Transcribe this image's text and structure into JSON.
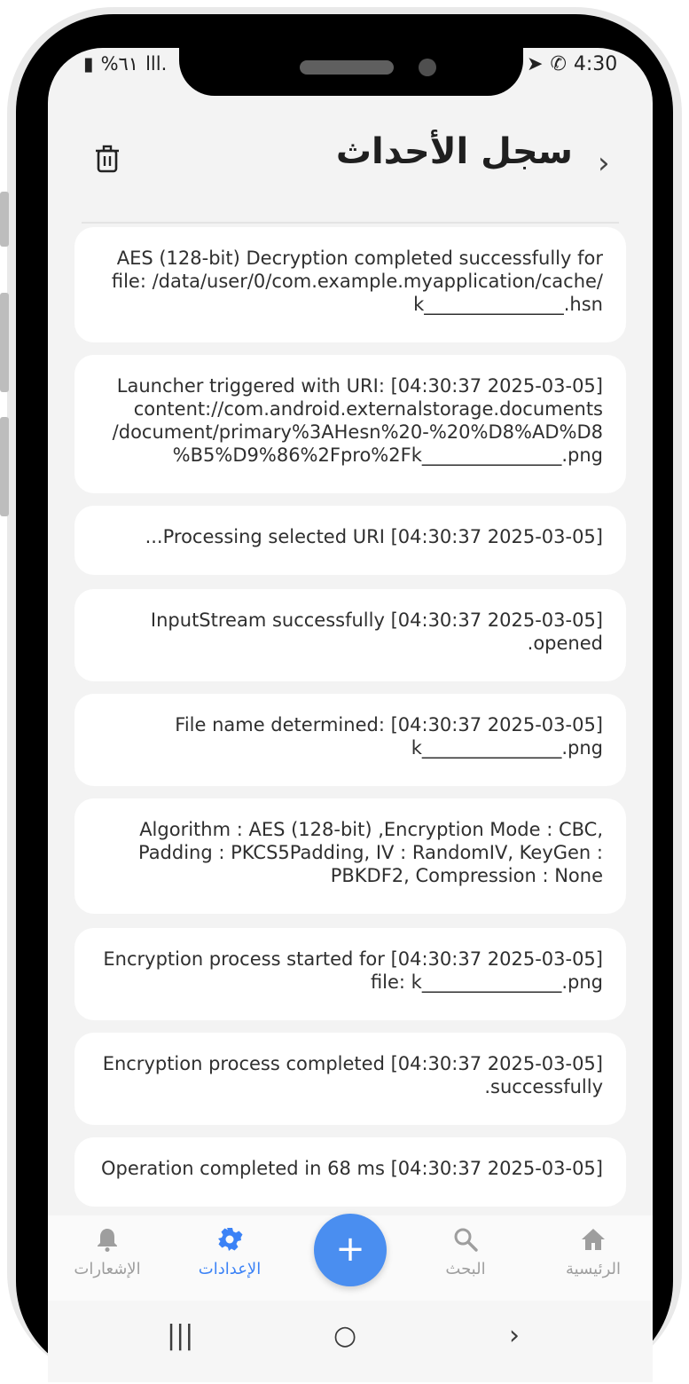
{
  "status_bar": {
    "battery_pct": "%٦١",
    "signal": "lll.",
    "time": "4:30"
  },
  "header": {
    "title": "سجل الأحداث",
    "back_chevron": "›"
  },
  "log_entries": [
    {
      "text": "AES (128-bit) Decryption completed successfully for file: /data/user/0/com.example.myapplication/cache/ k_______________.hsn"
    },
    {
      "text": "Launcher triggered with URI: [04:30:37 2025-03-05] content://com.android.externalstorage.documents /document/primary%3AHesn%20-%20%D8%AD%D8 %B5%D9%86%2Fpro%2Fk_______________.png"
    },
    {
      "text": "...Processing selected URI [04:30:37 2025-03-05]"
    },
    {
      "text": "InputStream successfully [04:30:37 2025-03-05] .opened"
    },
    {
      "text": "File name determined: [04:30:37 2025-03-05] k_______________.png"
    },
    {
      "text": "Algorithm : AES (128-bit) ,Encryption Mode : CBC, Padding : PKCS5Padding, IV : RandomIV, KeyGen : PBKDF2, Compression : None"
    },
    {
      "text": "Encryption process started for [04:30:37 2025-03-05] file: k_______________.png"
    },
    {
      "text": "Encryption process completed [04:30:37 2025-03-05] .successfully"
    },
    {
      "text": "Operation completed in 68 ms [04:30:37 2025-03-05]"
    }
  ],
  "bottom_nav": {
    "items": [
      {
        "label": "الإشعارات",
        "icon": "bell-icon"
      },
      {
        "label": "الإعدادات",
        "icon": "gear-icon",
        "active": true
      },
      {
        "label": "البحث",
        "icon": "search-icon"
      },
      {
        "label": "الرئيسية",
        "icon": "home-icon"
      }
    ],
    "fab_label": "+"
  },
  "system_nav": {
    "recents": "|||",
    "home": "○",
    "back": "›"
  },
  "colors": {
    "accent": "#3b82f6",
    "fab": "#4a8ef0",
    "background": "#f3f3f3",
    "card": "#ffffff"
  }
}
